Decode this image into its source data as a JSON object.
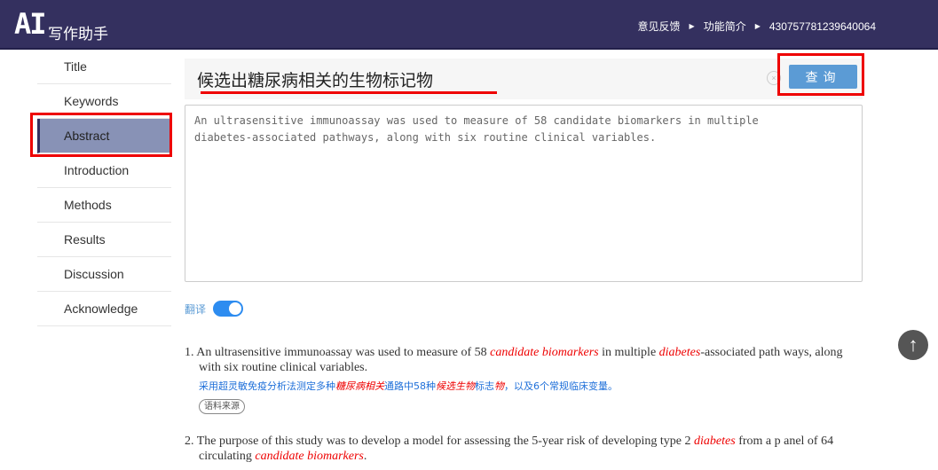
{
  "header": {
    "logo": "AI",
    "logo_sub": "写作助手",
    "nav": [
      "意见反馈",
      "功能简介",
      "430757781239640064"
    ]
  },
  "sidebar": {
    "items": [
      "Title",
      "Keywords",
      "Abstract",
      "Introduction",
      "Methods",
      "Results",
      "Discussion",
      "Acknowledge"
    ],
    "active": "Abstract"
  },
  "query": {
    "value": "候选出糖尿病相关的生物标记物",
    "button": "查询",
    "clear_icon": "close-circle-icon"
  },
  "textarea": {
    "value": "An ultrasensitive immunoassay was used to measure of 58 candidate biomarkers in multiple\ndiabetes-associated pathways, along with six routine clinical variables."
  },
  "translate": {
    "label": "翻译",
    "on": true
  },
  "results": [
    {
      "num": "1.",
      "parts": [
        {
          "t": "An ultrasensitive immunoassay was used to measure of 58 "
        },
        {
          "t": "candidate biomarkers",
          "hl": true
        },
        {
          "t": " in multiple "
        },
        {
          "t": "diabetes",
          "hl": true
        },
        {
          "t": "-associated path ways, along with six routine clinical variables."
        }
      ],
      "zh": [
        {
          "t": "采用超灵敏免疫分析法测定多种"
        },
        {
          "t": "糖尿病相关",
          "hl": true
        },
        {
          "t": "通路中58种"
        },
        {
          "t": "候选生物",
          "hl": true
        },
        {
          "t": "标志"
        },
        {
          "t": "物",
          "hl": true
        },
        {
          "t": "，以及6个常规临床变量。"
        }
      ],
      "source": "语料来源"
    },
    {
      "num": "2.",
      "parts": [
        {
          "t": "The purpose of this study was to develop a model for assessing the 5-year risk of developing type 2 "
        },
        {
          "t": "diabetes",
          "hl": true
        },
        {
          "t": " from a p anel of 64 circulating "
        },
        {
          "t": "candidate biomarkers",
          "hl": true
        },
        {
          "t": "."
        }
      ]
    }
  ],
  "colors": {
    "header": "#34305f",
    "accent": "#5b9bd5",
    "highlight": "#e00000",
    "annotation": "#e00000"
  }
}
